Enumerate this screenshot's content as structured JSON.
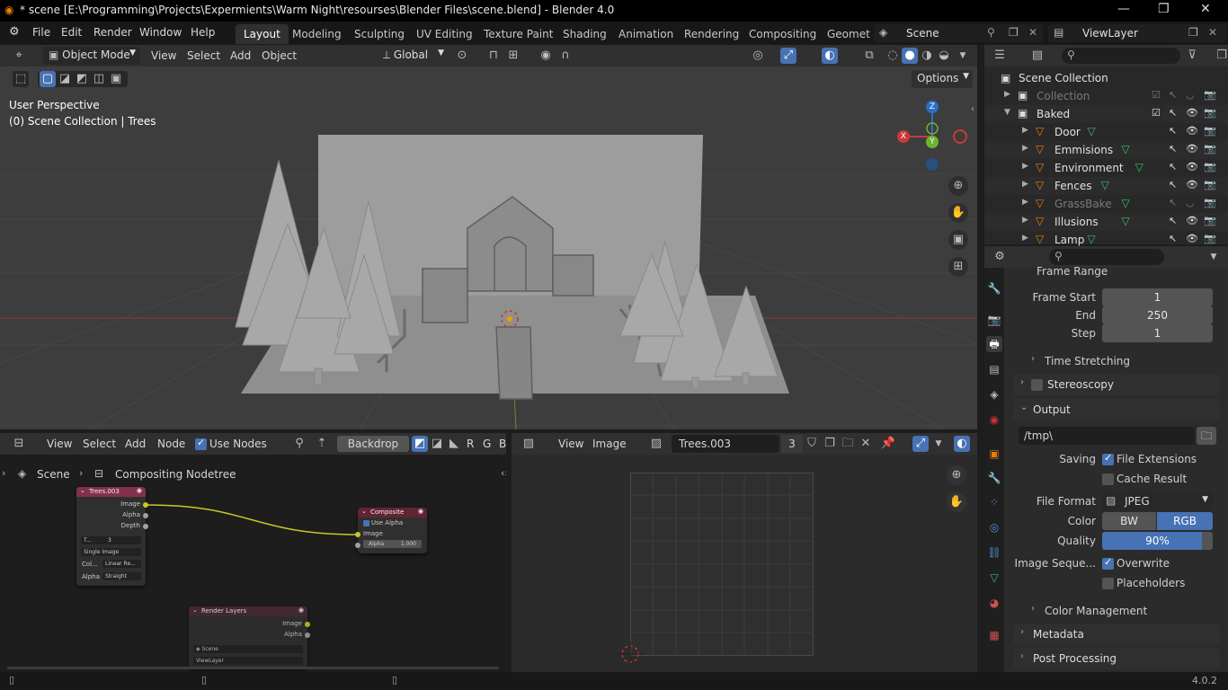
{
  "window": {
    "title": "* scene [E:\\Programming\\Projects\\Expermients\\Warm Night\\resourses\\Blender Files\\scene.blend] - Blender 4.0",
    "controls": [
      "—",
      "❐",
      "✕"
    ]
  },
  "menubar": {
    "menus": [
      "File",
      "Edit",
      "Render",
      "Window",
      "Help"
    ],
    "workspaces": [
      "Layout",
      "Modeling",
      "Sculpting",
      "UV Editing",
      "Texture Paint",
      "Shading",
      "Animation",
      "Rendering",
      "Compositing",
      "Geomet"
    ],
    "active_workspace": "Layout",
    "scene": "Scene",
    "view_layer": "ViewLayer"
  },
  "viewport": {
    "mode": "Object Mode",
    "menus": [
      "View",
      "Select",
      "Add",
      "Object"
    ],
    "orientation": "Global",
    "options_label": "Options",
    "overlay_line1": "User Perspective",
    "overlay_line2": "(0) Scene Collection | Trees",
    "gizmo": {
      "x": "X",
      "y": "Y",
      "z": "Z"
    }
  },
  "outliner": {
    "search_placeholder": "",
    "root": "Scene Collection",
    "items": [
      {
        "label": "Collection",
        "dim": true,
        "level": 1
      },
      {
        "label": "Baked",
        "dim": false,
        "level": 1
      },
      {
        "label": "Door",
        "dim": false,
        "level": 2
      },
      {
        "label": "Emmisions",
        "dim": false,
        "level": 2
      },
      {
        "label": "Environment",
        "dim": false,
        "level": 2
      },
      {
        "label": "Fences",
        "dim": false,
        "level": 2
      },
      {
        "label": "GrassBake",
        "dim": true,
        "level": 2
      },
      {
        "label": "Illusions",
        "dim": false,
        "level": 2
      },
      {
        "label": "Lamp",
        "dim": false,
        "level": 2
      }
    ]
  },
  "properties": {
    "section_top": "Frame Range",
    "frame_start_label": "Frame Start",
    "frame_start": "1",
    "end_label": "End",
    "end": "250",
    "step_label": "Step",
    "step": "1",
    "time_stretching": "Time Stretching",
    "stereoscopy": "Stereoscopy",
    "output": "Output",
    "output_path": "/tmp\\",
    "saving_label": "Saving",
    "file_extensions": "File Extensions",
    "cache_result": "Cache Result",
    "file_format_label": "File Format",
    "file_format": "JPEG",
    "color_label": "Color",
    "color_bw": "BW",
    "color_rgb": "RGB",
    "quality_label": "Quality",
    "quality": "90%",
    "quality_fraction": 0.9,
    "image_sequence_label": "Image Seque...",
    "overwrite": "Overwrite",
    "placeholders": "Placeholders",
    "color_management": "Color Management",
    "metadata": "Metadata",
    "post_processing": "Post Processing"
  },
  "node_editor": {
    "menus": [
      "View",
      "Select",
      "Add",
      "Node"
    ],
    "use_nodes": "Use Nodes",
    "backdrop": "Backdrop",
    "channel_letters": [
      "R",
      "G",
      "B"
    ],
    "breadcrumb_scene": "Scene",
    "breadcrumb_tree": "Compositing Nodetree",
    "image_node": {
      "title": "Trees.003",
      "outputs": [
        "Image",
        "Alpha",
        "Depth"
      ],
      "img_name": "T...",
      "users": "3",
      "source": "Single Image",
      "col_label": "Col...",
      "col_value": "Linear Re...",
      "alpha_label": "Alpha",
      "alpha_value": "Straight"
    },
    "composite_node": {
      "title": "Composite",
      "use_alpha": "Use Alpha",
      "input_image": "Image",
      "alpha_label": "Alpha",
      "alpha_value": "1.000"
    },
    "render_layers_node": {
      "title": "Render Layers",
      "outputs": [
        "Image",
        "Alpha"
      ],
      "scene": "Scene",
      "view_layer": "ViewLayer"
    }
  },
  "image_editor": {
    "menus": [
      "View",
      "Image"
    ],
    "image_name": "Trees.003",
    "users": "3"
  },
  "status": {
    "version": "4.0.2"
  },
  "colors": {
    "accent": "#4772b3",
    "image_node_header": "#83314a",
    "composite_header": "#622433",
    "link": "#c7c729",
    "socket_image": "#c7c729",
    "socket_value": "#a1a1a1"
  }
}
